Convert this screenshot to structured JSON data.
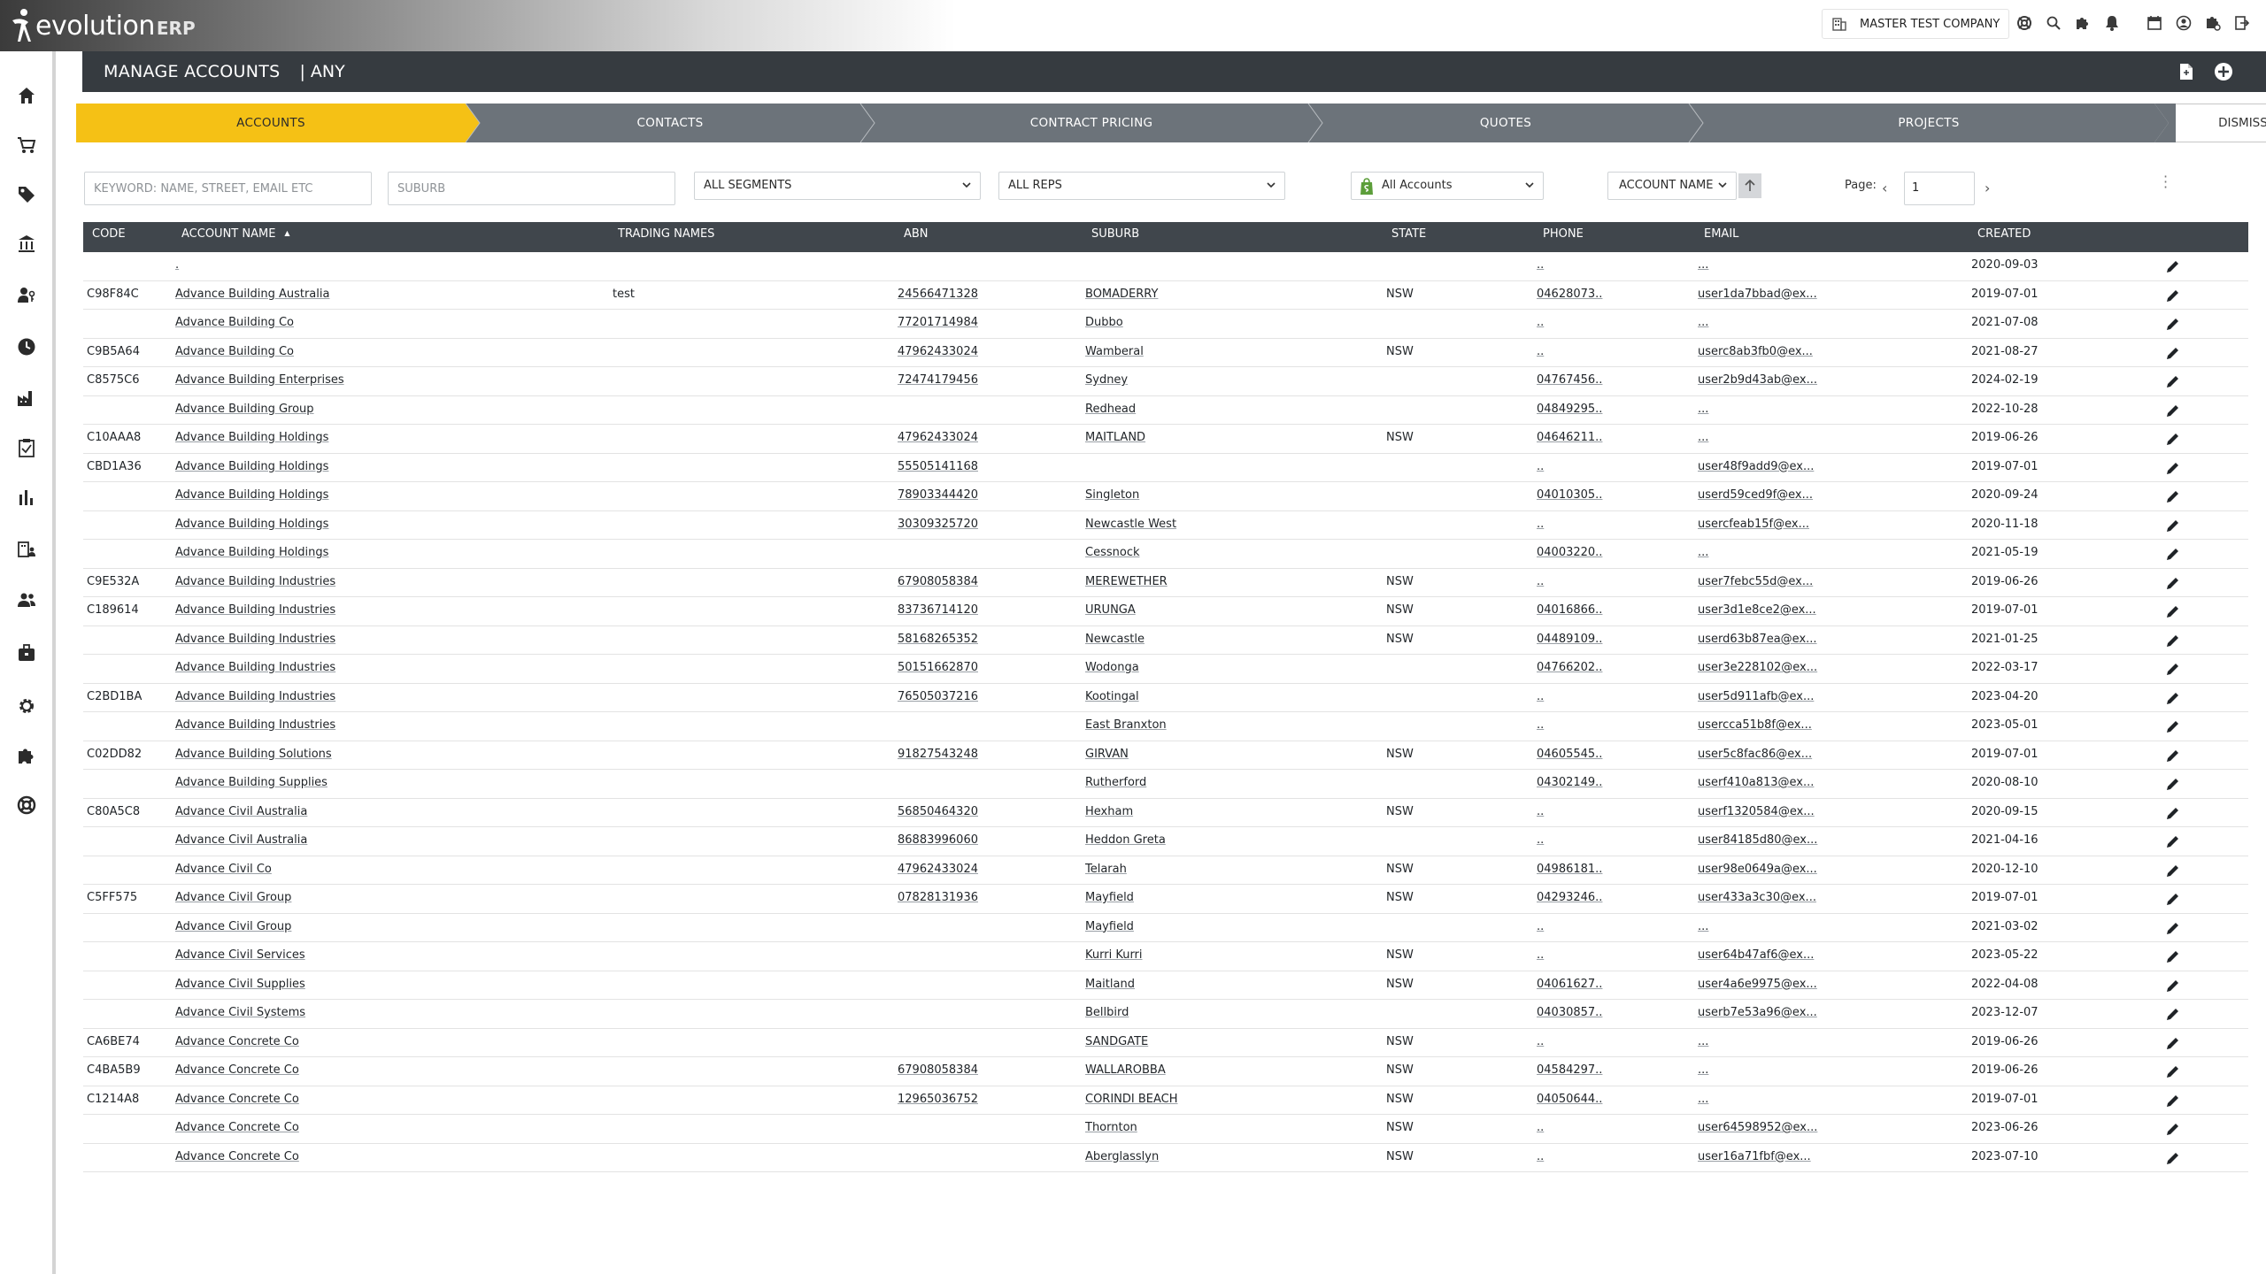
{
  "app": {
    "logo_text": "evolution",
    "logo_suffix": "ERP",
    "company": "MASTER TEST COMPANY"
  },
  "header": {
    "title": "MANAGE ACCOUNTS",
    "subtitle": "| ANY"
  },
  "tabs": [
    {
      "label": "ACCOUNTS",
      "active": true
    },
    {
      "label": "CONTACTS",
      "active": false
    },
    {
      "label": "CONTRACT PRICING",
      "active": false
    },
    {
      "label": "QUOTES",
      "active": false
    },
    {
      "label": "PROJECTS",
      "active": false
    }
  ],
  "dismiss_label": "DISMISS",
  "filters": {
    "keyword_placeholder": "KEYWORD: NAME, STREET, EMAIL ETC",
    "suburb_placeholder": "SUBURB",
    "segments": "ALL SEGMENTS",
    "reps": "ALL REPS",
    "accounts": "All Accounts",
    "sort_by": "ACCOUNT NAME"
  },
  "pagination": {
    "label": "Page:",
    "page": "1"
  },
  "colors": {
    "accent": "#f5c115",
    "tab_inactive": "#6c737a",
    "header_bg": "#363b40",
    "table_header_bg": "#40464c"
  },
  "table": {
    "columns": [
      "CODE",
      "ACCOUNT NAME",
      "TRADING NAMES",
      "ABN",
      "SUBURB",
      "STATE",
      "PHONE",
      "EMAIL",
      "CREATED"
    ],
    "rows": [
      {
        "code": "",
        "name": ".",
        "trading": "",
        "abn": "",
        "suburb": "",
        "state": "",
        "phone": "..",
        "email": "...",
        "created": "2020-09-03"
      },
      {
        "code": "C98F84C",
        "name": "Advance Building Australia",
        "trading": "test",
        "abn": "24566471328",
        "suburb": "BOMADERRY",
        "state": "NSW",
        "phone": "04628073..",
        "email": "user1da7bbad@ex...",
        "created": "2019-07-01"
      },
      {
        "code": "",
        "name": "Advance Building Co",
        "trading": "",
        "abn": "77201714984",
        "suburb": "Dubbo",
        "state": "",
        "phone": "..",
        "email": "...",
        "created": "2021-07-08"
      },
      {
        "code": "C9B5A64",
        "name": "Advance Building Co",
        "trading": "",
        "abn": "47962433024",
        "suburb": "Wamberal",
        "state": "NSW",
        "phone": "..",
        "email": "userc8ab3fb0@ex...",
        "created": "2021-08-27"
      },
      {
        "code": "C8575C6",
        "name": "Advance Building Enterprises",
        "trading": "",
        "abn": "72474179456",
        "suburb": "Sydney",
        "state": "",
        "phone": "04767456..",
        "email": "user2b9d43ab@ex...",
        "created": "2024-02-19"
      },
      {
        "code": "",
        "name": "Advance Building Group",
        "trading": "",
        "abn": "",
        "suburb": "Redhead",
        "state": "",
        "phone": "04849295..",
        "email": "...",
        "created": "2022-10-28"
      },
      {
        "code": "C10AAA8",
        "name": "Advance Building Holdings",
        "trading": "",
        "abn": "47962433024",
        "suburb": "MAITLAND",
        "state": "NSW",
        "phone": "04646211..",
        "email": "...",
        "created": "2019-06-26"
      },
      {
        "code": "CBD1A36",
        "name": "Advance Building Holdings",
        "trading": "",
        "abn": "55505141168",
        "suburb": "",
        "state": "",
        "phone": "..",
        "email": "user48f9add9@ex...",
        "created": "2019-07-01"
      },
      {
        "code": "",
        "name": "Advance Building Holdings",
        "trading": "",
        "abn": "78903344420",
        "suburb": "Singleton",
        "state": "",
        "phone": "04010305..",
        "email": "userd59ced9f@ex...",
        "created": "2020-09-24"
      },
      {
        "code": "",
        "name": "Advance Building Holdings",
        "trading": "",
        "abn": "30309325720",
        "suburb": "Newcastle West",
        "state": "",
        "phone": "..",
        "email": "usercfeab15f@ex...",
        "created": "2020-11-18"
      },
      {
        "code": "",
        "name": "Advance Building Holdings",
        "trading": "",
        "abn": "",
        "suburb": "Cessnock",
        "state": "",
        "phone": "04003220..",
        "email": "...",
        "created": "2021-05-19"
      },
      {
        "code": "C9E532A",
        "name": "Advance Building Industries",
        "trading": "",
        "abn": "67908058384",
        "suburb": "MEREWETHER",
        "state": "NSW",
        "phone": "..",
        "email": "user7febc55d@ex...",
        "created": "2019-06-26"
      },
      {
        "code": "C189614",
        "name": "Advance Building Industries",
        "trading": "",
        "abn": "83736714120",
        "suburb": "URUNGA",
        "state": "NSW",
        "phone": "04016866..",
        "email": "user3d1e8ce2@ex...",
        "created": "2019-07-01"
      },
      {
        "code": "",
        "name": "Advance Building Industries",
        "trading": "",
        "abn": "58168265352",
        "suburb": "Newcastle",
        "state": "NSW",
        "phone": "04489109..",
        "email": "userd63b87ea@ex...",
        "created": "2021-01-25"
      },
      {
        "code": "",
        "name": "Advance Building Industries",
        "trading": "",
        "abn": "50151662870",
        "suburb": "Wodonga",
        "state": "",
        "phone": "04766202..",
        "email": "user3e228102@ex...",
        "created": "2022-03-17"
      },
      {
        "code": "C2BD1BA",
        "name": "Advance Building Industries",
        "trading": "",
        "abn": "76505037216",
        "suburb": "Kootingal",
        "state": "",
        "phone": "..",
        "email": "user5d911afb@ex...",
        "created": "2023-04-20"
      },
      {
        "code": "",
        "name": "Advance Building Industries",
        "trading": "",
        "abn": "",
        "suburb": "East Branxton",
        "state": "",
        "phone": "..",
        "email": "usercca51b8f@ex...",
        "created": "2023-05-01"
      },
      {
        "code": "C02DD82",
        "name": "Advance Building Solutions",
        "trading": "",
        "abn": "91827543248",
        "suburb": "GIRVAN",
        "state": "NSW",
        "phone": "04605545..",
        "email": "user5c8fac86@ex...",
        "created": "2019-07-01"
      },
      {
        "code": "",
        "name": "Advance Building Supplies",
        "trading": "",
        "abn": "",
        "suburb": "Rutherford",
        "state": "",
        "phone": "04302149..",
        "email": "userf410a813@ex...",
        "created": "2020-08-10"
      },
      {
        "code": "C80A5C8",
        "name": "Advance Civil Australia",
        "trading": "",
        "abn": "56850464320",
        "suburb": "Hexham",
        "state": "NSW",
        "phone": "..",
        "email": "userf1320584@ex...",
        "created": "2020-09-15"
      },
      {
        "code": "",
        "name": "Advance Civil Australia",
        "trading": "",
        "abn": "86883996060",
        "suburb": "Heddon Greta",
        "state": "",
        "phone": "..",
        "email": "user84185d80@ex...",
        "created": "2021-04-16"
      },
      {
        "code": "",
        "name": "Advance Civil Co",
        "trading": "",
        "abn": "47962433024",
        "suburb": "Telarah",
        "state": "NSW",
        "phone": "04986181..",
        "email": "user98e0649a@ex...",
        "created": "2020-12-10"
      },
      {
        "code": "C5FF575",
        "name": "Advance Civil Group",
        "trading": "",
        "abn": "07828131936",
        "suburb": "Mayfield",
        "state": "NSW",
        "phone": "04293246..",
        "email": "user433a3c30@ex...",
        "created": "2019-07-01"
      },
      {
        "code": "",
        "name": "Advance Civil Group",
        "trading": "",
        "abn": "",
        "suburb": "Mayfield",
        "state": "",
        "phone": "..",
        "email": "...",
        "created": "2021-03-02"
      },
      {
        "code": "",
        "name": "Advance Civil Services",
        "trading": "",
        "abn": "",
        "suburb": "Kurri Kurri",
        "state": "NSW",
        "phone": "..",
        "email": "user64b47af6@ex...",
        "created": "2023-05-22"
      },
      {
        "code": "",
        "name": "Advance Civil Supplies",
        "trading": "",
        "abn": "",
        "suburb": "Maitland",
        "state": "NSW",
        "phone": "04061627..",
        "email": "user4a6e9975@ex...",
        "created": "2022-04-08"
      },
      {
        "code": "",
        "name": "Advance Civil Systems",
        "trading": "",
        "abn": "",
        "suburb": "Bellbird",
        "state": "",
        "phone": "04030857..",
        "email": "userb7e53a96@ex...",
        "created": "2023-12-07"
      },
      {
        "code": "CA6BE74",
        "name": "Advance Concrete Co",
        "trading": "",
        "abn": "",
        "suburb": "SANDGATE",
        "state": "NSW",
        "phone": "..",
        "email": "...",
        "created": "2019-06-26"
      },
      {
        "code": "C4BA5B9",
        "name": "Advance Concrete Co",
        "trading": "",
        "abn": "67908058384",
        "suburb": "WALLAROBBA",
        "state": "NSW",
        "phone": "04584297..",
        "email": "...",
        "created": "2019-06-26"
      },
      {
        "code": "C1214A8",
        "name": "Advance Concrete Co",
        "trading": "",
        "abn": "12965036752",
        "suburb": "CORINDI BEACH",
        "state": "NSW",
        "phone": "04050644..",
        "email": "...",
        "created": "2019-07-01"
      },
      {
        "code": "",
        "name": "Advance Concrete Co",
        "trading": "",
        "abn": "",
        "suburb": "Thornton",
        "state": "NSW",
        "phone": "..",
        "email": "user64598952@ex...",
        "created": "2023-06-26"
      },
      {
        "code": "",
        "name": "Advance Concrete Co",
        "trading": "",
        "abn": "",
        "suburb": "Aberglasslyn",
        "state": "NSW",
        "phone": "..",
        "email": "user16a71fbf@ex...",
        "created": "2023-07-10"
      }
    ]
  }
}
